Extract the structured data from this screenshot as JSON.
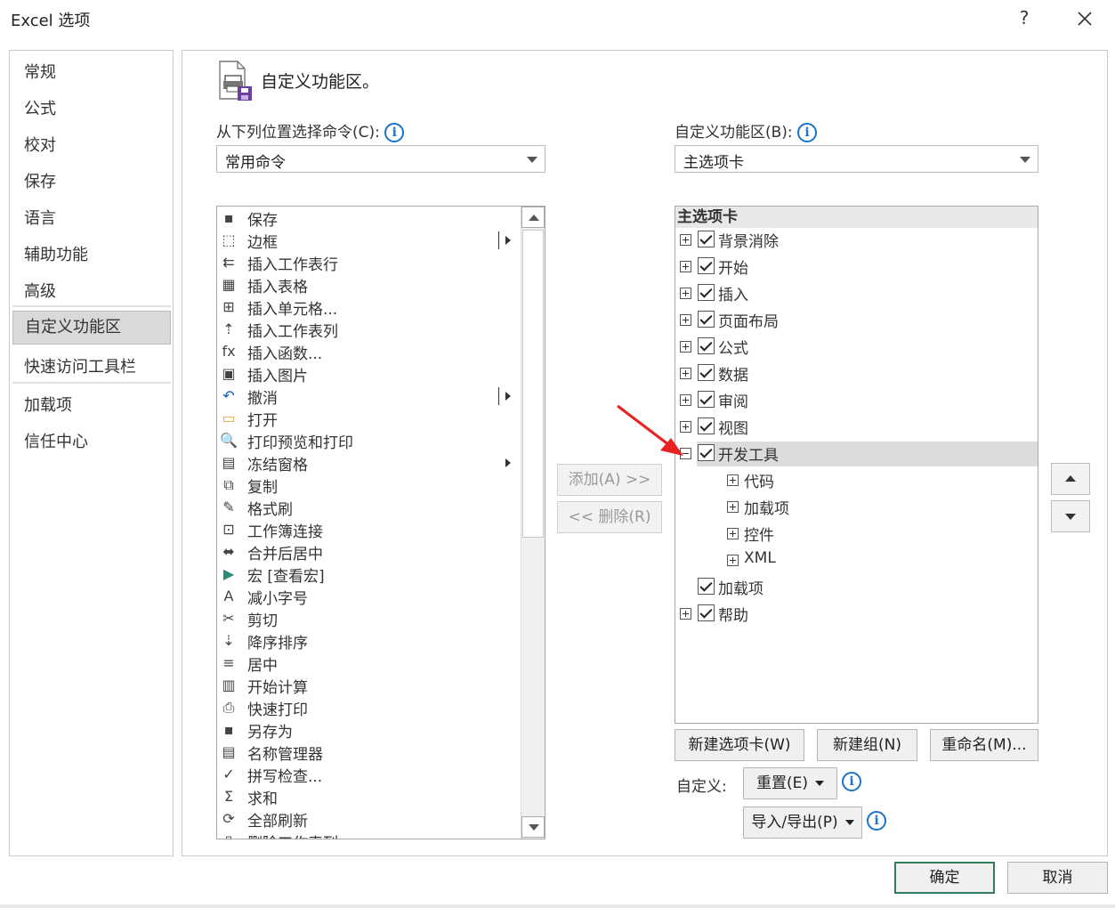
{
  "window": {
    "title": "Excel 选项",
    "help_label": "?"
  },
  "nav": {
    "items": [
      {
        "label": "常规"
      },
      {
        "label": "公式"
      },
      {
        "label": "校对"
      },
      {
        "label": "保存"
      },
      {
        "label": "语言"
      },
      {
        "label": "辅助功能"
      },
      {
        "label": "高级"
      },
      {
        "label": "自定义功能区",
        "selected": true
      },
      {
        "label": "快速访问工具栏"
      },
      {
        "label": "加载项"
      },
      {
        "label": "信任中心"
      }
    ]
  },
  "panel": {
    "title": "自定义功能区。",
    "left_label": "从下列位置选择命令(C):",
    "left_combo_value": "常用命令",
    "right_label": "自定义功能区(B):",
    "right_combo_value": "主选项卡"
  },
  "commands": [
    {
      "icon": "save-icon",
      "glyph": "▪",
      "label": "保存"
    },
    {
      "icon": "border-icon",
      "glyph": "⬚",
      "label": "边框",
      "sub": true,
      "bar": true
    },
    {
      "icon": "insert-row-icon",
      "glyph": "⇇",
      "label": "插入工作表行"
    },
    {
      "icon": "insert-table-icon",
      "glyph": "▦",
      "label": "插入表格"
    },
    {
      "icon": "insert-cells-icon",
      "glyph": "⊞",
      "label": "插入单元格..."
    },
    {
      "icon": "insert-column-icon",
      "glyph": "⇡",
      "label": "插入工作表列"
    },
    {
      "icon": "function-icon",
      "glyph": "fx",
      "label": "插入函数..."
    },
    {
      "icon": "picture-icon",
      "glyph": "▣",
      "label": "插入图片"
    },
    {
      "icon": "undo-icon",
      "glyph": "↶",
      "label": "撤消",
      "sub": true,
      "bar": true
    },
    {
      "icon": "folder-icon",
      "glyph": "▭",
      "label": "打开"
    },
    {
      "icon": "print-preview-icon",
      "glyph": "🔍",
      "label": "打印预览和打印"
    },
    {
      "icon": "freeze-panes-icon",
      "glyph": "▤",
      "label": "冻结窗格",
      "sub": true
    },
    {
      "icon": "copy-icon",
      "glyph": "⧉",
      "label": "复制"
    },
    {
      "icon": "format-painter-icon",
      "glyph": "✎",
      "label": "格式刷"
    },
    {
      "icon": "workbook-connection-icon",
      "glyph": "⊡",
      "label": "工作簿连接"
    },
    {
      "icon": "merge-center-icon",
      "glyph": "⬌",
      "label": "合并后居中"
    },
    {
      "icon": "macro-icon",
      "glyph": "▶",
      "label": "宏 [查看宏]"
    },
    {
      "icon": "decrease-font-icon",
      "glyph": "A",
      "label": "减小字号"
    },
    {
      "icon": "cut-icon",
      "glyph": "✂",
      "label": "剪切"
    },
    {
      "icon": "sort-desc-icon",
      "glyph": "⇣",
      "label": "降序排序"
    },
    {
      "icon": "center-icon",
      "glyph": "≡",
      "label": "居中"
    },
    {
      "icon": "calculator-icon",
      "glyph": "▥",
      "label": "开始计算"
    },
    {
      "icon": "quick-print-icon",
      "glyph": "⎙",
      "label": "快速打印"
    },
    {
      "icon": "save-as-icon",
      "glyph": "▪",
      "label": "另存为"
    },
    {
      "icon": "name-manager-icon",
      "glyph": "▤",
      "label": "名称管理器"
    },
    {
      "icon": "spelling-icon",
      "glyph": "✓",
      "label": "拼写检查..."
    },
    {
      "icon": "sum-icon",
      "glyph": "Σ",
      "label": "求和"
    },
    {
      "icon": "refresh-all-icon",
      "glyph": "⟳",
      "label": "全部刷新"
    },
    {
      "icon": "delete-column-icon",
      "glyph": "▯",
      "label": "删除工作表列"
    }
  ],
  "buttons": {
    "add": "添加(A) >>",
    "remove": "<< 删除(R)",
    "new_tab": "新建选项卡(W)",
    "new_group": "新建组(N)",
    "rename": "重命名(M)...",
    "customize_label": "自定义:",
    "reset": "重置(E)",
    "import_export": "导入/导出(P)",
    "ok": "确定",
    "cancel": "取消"
  },
  "tree": {
    "header": "主选项卡",
    "rows": [
      {
        "label": "背景消除",
        "level": 0,
        "expander": "plus",
        "checked": true
      },
      {
        "label": "开始",
        "level": 0,
        "expander": "plus",
        "checked": true
      },
      {
        "label": "插入",
        "level": 0,
        "expander": "plus",
        "checked": true
      },
      {
        "label": "页面布局",
        "level": 0,
        "expander": "plus",
        "checked": true
      },
      {
        "label": "公式",
        "level": 0,
        "expander": "plus",
        "checked": true
      },
      {
        "label": "数据",
        "level": 0,
        "expander": "plus",
        "checked": true
      },
      {
        "label": "审阅",
        "level": 0,
        "expander": "plus",
        "checked": true
      },
      {
        "label": "视图",
        "level": 0,
        "expander": "plus",
        "checked": true
      },
      {
        "label": "开发工具",
        "level": 0,
        "expander": "minus",
        "checked": true,
        "selected": true
      },
      {
        "label": "代码",
        "level": 1,
        "expander": "plus"
      },
      {
        "label": "加载项",
        "level": 1,
        "expander": "plus"
      },
      {
        "label": "控件",
        "level": 1,
        "expander": "plus"
      },
      {
        "label": "XML",
        "level": 1,
        "expander": "plus"
      },
      {
        "label": "加载项",
        "level": 0,
        "expander": "none",
        "checked": true
      },
      {
        "label": "帮助",
        "level": 0,
        "expander": "plus",
        "checked": true
      }
    ]
  },
  "colors": {
    "accent_blue": "#1a73c9",
    "ok_border": "#2e7d5b",
    "annotation_arrow": "#e8201f"
  }
}
